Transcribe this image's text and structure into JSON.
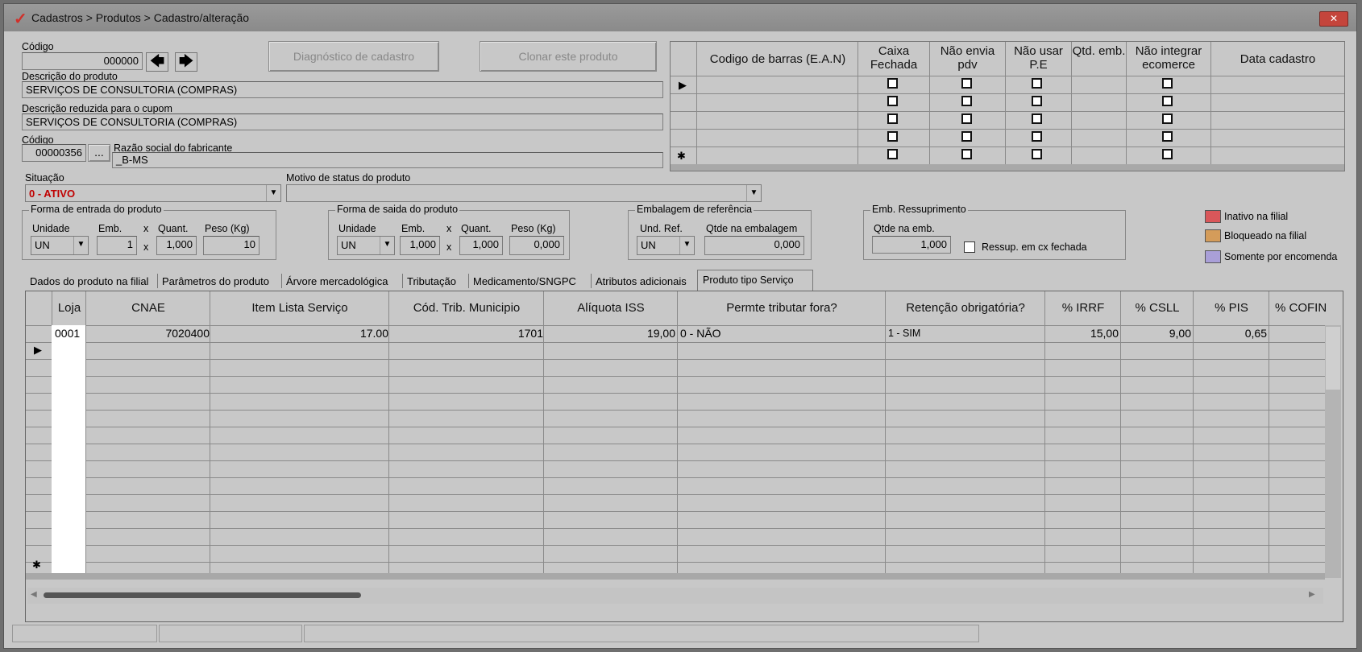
{
  "window": {
    "title": "Cadastros > Produtos > Cadastro/alteração",
    "logo": "✓",
    "close_label": "✕"
  },
  "header": {
    "codigo_label": "Código",
    "codigo_value": "000000",
    "prev_icon": "arrow-left-icon",
    "next_icon": "arrow-right-icon",
    "diag_button": "Diagnóstico de cadastro",
    "clone_button": "Clonar este produto",
    "descricao_label": "Descrição  do produto",
    "descricao_value": "SERVIÇOS DE CONSULTORIA (COMPRAS)",
    "desc_reduzida_label": "Descrição reduzida para o cupom",
    "desc_reduzida_value": "SERVIÇOS DE CONSULTORIA (COMPRAS)",
    "fab_codigo_label": "Código",
    "fab_codigo_value": "00000356",
    "fab_lookup_label": "...",
    "razao_label": "Razão social do fabricante",
    "razao_value": "_B-MS",
    "situacao_label": "Situação",
    "situacao_value": "0 - ATIVO",
    "motivo_label": "Motivo de status do produto",
    "motivo_value": ""
  },
  "barcode_grid": {
    "columns": [
      "Codigo de barras (E.A.N)",
      "Caixa Fechada",
      "Não envia pdv",
      "Não usar P.E",
      "Qtd. emb.",
      "Não integrar ecomerce",
      "Data cadastro"
    ],
    "row_indicator": "▶",
    "new_row_indicator": "✱"
  },
  "entrada": {
    "title": "Forma de entrada do produto",
    "unidade_label": "Unidade",
    "emb_label": "Emb.",
    "quant_label": "Quant.",
    "peso_label": "Peso (Kg)",
    "unidade": "UN",
    "emb": "1",
    "quant": "1,000",
    "peso": "10",
    "x": "x"
  },
  "saida": {
    "title": "Forma de saida do produto",
    "unidade_label": "Unidade",
    "emb_label": "Emb.",
    "quant_label": "Quant.",
    "peso_label": "Peso (Kg)",
    "unidade": "UN",
    "emb": "1,000",
    "quant": "1,000",
    "peso": "0,000",
    "x": "x"
  },
  "embalagem": {
    "title": "Embalagem de referência",
    "und_label": "Und. Ref.",
    "qtde_label": "Qtde na embalagem",
    "und": "UN",
    "qtde": "0,000"
  },
  "ressup": {
    "title": "Emb. Ressuprimento",
    "qtde_label": "Qtde na emb.",
    "qtde": "1,000",
    "check_label": "Ressup. em cx fechada"
  },
  "legend": [
    {
      "label": "Inativo na filial",
      "color": "#d9575a"
    },
    {
      "label": "Bloqueado na filial",
      "color": "#d49c5a"
    },
    {
      "label": "Somente por encomenda",
      "color": "#a99fd8"
    }
  ],
  "tabs": [
    "Dados do produto na filial",
    "Parâmetros do produto",
    "Árvore mercadológica",
    "Tributação",
    "Medicamento/SNGPC",
    "Atributos adicionais",
    "Produto tipo Serviço"
  ],
  "service_grid": {
    "columns": [
      "Loja",
      "CNAE",
      "Item Lista Serviço",
      "Cód. Trib. Municipio",
      "Alíquota ISS",
      "Permte tributar fora?",
      "Retenção obrigatória?",
      "% IRRF",
      "% CSLL",
      "% PIS",
      "% COFIN"
    ],
    "row": [
      "0001",
      "7020400",
      "17.00",
      "1701",
      "19,00",
      "0 - NÃO",
      "1 - SIM",
      "15,00",
      "9,00",
      "0,65",
      ""
    ],
    "current_indicator": "▶",
    "new_row_indicator": "✱",
    "scroll_left": "◀",
    "scroll_right": "▶"
  },
  "colors": {
    "window_bg": "#c8c8c8",
    "title_bg": "#8f8f8f",
    "close_red": "#c4453c",
    "status_red": "#c00000"
  }
}
